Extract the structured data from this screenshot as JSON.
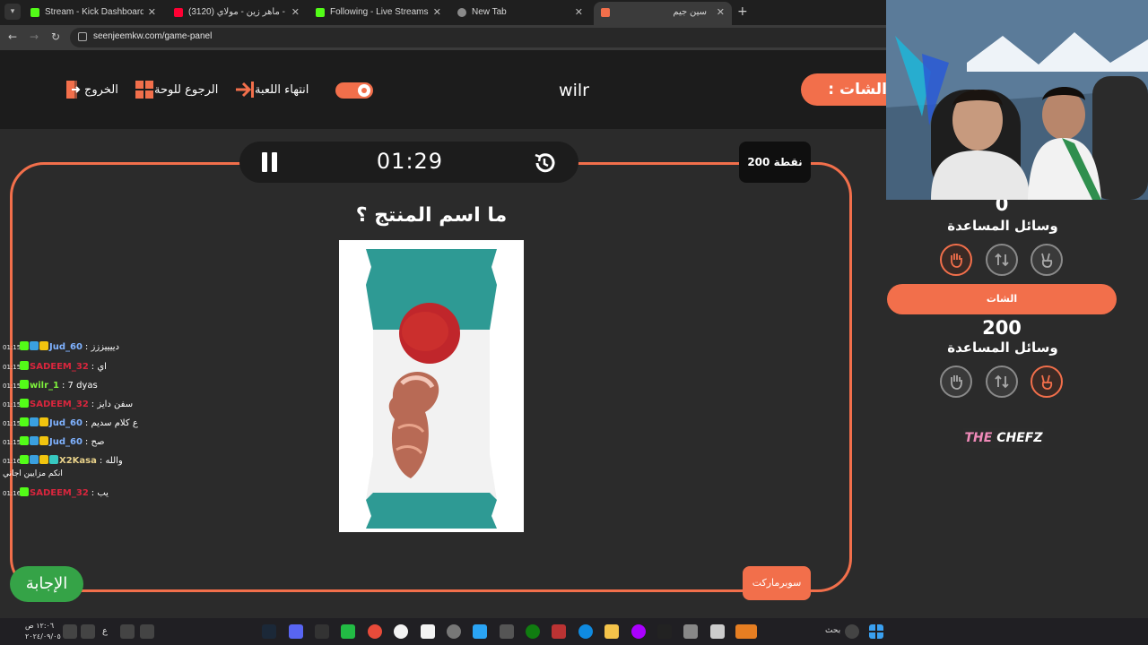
{
  "browser": {
    "tabs": [
      {
        "title": "Stream - Kick Dashboard",
        "icon": "kick-icon"
      },
      {
        "title": "(3120) ماهر زين - مولاي - YouTube",
        "icon": "youtube-icon"
      },
      {
        "title": "Following - Live Streams on Kick",
        "icon": "kick-icon"
      },
      {
        "title": "New Tab",
        "icon": "chrome-icon"
      },
      {
        "title": "سين جيم",
        "icon": "seenjeem-icon"
      }
    ],
    "url": "seenjeemkw.com/game-panel"
  },
  "header": {
    "exit_label": "الخروج",
    "back_label": "الرجوع للوحة",
    "end_game_label": "انتهاء اللعبة",
    "player_name": "wilr",
    "chat_label": ": الشات"
  },
  "board": {
    "timer": "01:29",
    "points": "200 نقطة",
    "question": "ما اسم المنتج ؟",
    "category": "سوبرماركت",
    "answer_label": "الإجابة"
  },
  "chat": {
    "lines": [
      {
        "time": "01:15",
        "user": "Jud_60",
        "msg": ": دييييززز",
        "color": "#7fb2ff"
      },
      {
        "time": "01:15",
        "user": "SADEEM_32",
        "msg": ": اي",
        "color": "#d9263d"
      },
      {
        "time": "01:15",
        "user": "wilr_1",
        "msg": ": 7 dyas",
        "color": "#7ef23c"
      },
      {
        "time": "01:15",
        "user": "SADEEM_32",
        "msg": ": سفن دايز",
        "color": "#d9263d"
      },
      {
        "time": "01:15",
        "user": "Jud_60",
        "msg": ": ع كلام سديم",
        "color": "#7fb2ff"
      },
      {
        "time": "01:15",
        "user": "Jud_60",
        "msg": ": صح",
        "color": "#7fb2ff"
      },
      {
        "time": "01:16",
        "user": "X2Kasa",
        "msg": ": والله",
        "color": "#e9d28a"
      },
      {
        "time": "01:16",
        "user": "SADEEM_32",
        "msg": ": يب",
        "color": "#d9263d"
      }
    ],
    "continuation": "انكم مزايين اجاني"
  },
  "teams": {
    "top_score": "0",
    "lifelines_label": "وسائل المساعدة",
    "team_name": "الشات",
    "bottom_score": "200"
  },
  "sponsor": {
    "the": "THE",
    "chefz": "CHEFZ"
  },
  "taskbar": {
    "search_label": "بحث",
    "lang": "ع",
    "time": "١٢:٠٦ ص",
    "date": "٢٠٢٤/٠٩/٠٥"
  },
  "colors": {
    "accent": "#f26f4b",
    "answer": "#35a347",
    "panel": "#1c1c1c",
    "bg": "#2b2b2b"
  }
}
